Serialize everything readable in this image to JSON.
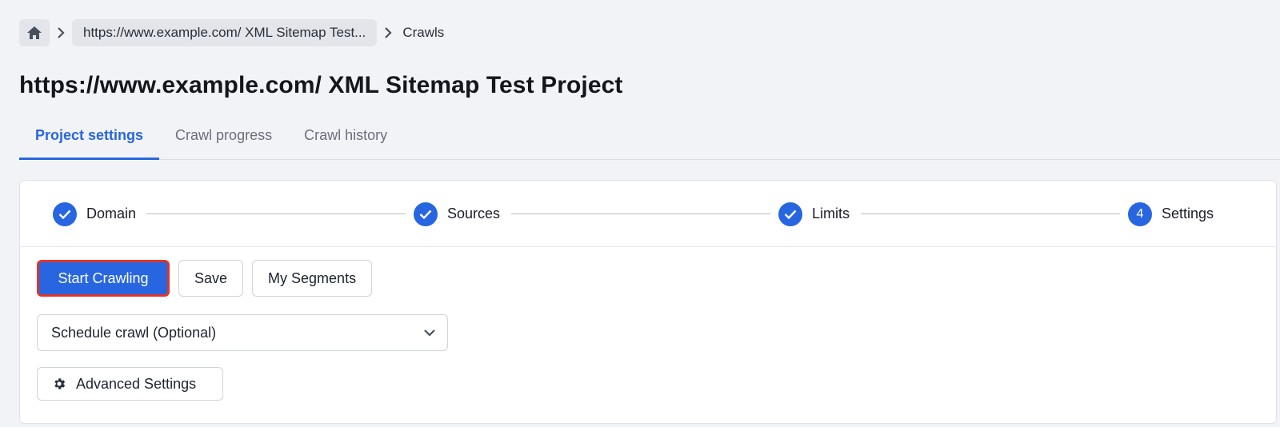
{
  "breadcrumb": {
    "home_icon": "home-icon",
    "project": "https://www.example.com/ XML Sitemap Test...",
    "current": "Crawls"
  },
  "page": {
    "title": "https://www.example.com/ XML Sitemap Test Project"
  },
  "tabs": [
    {
      "label": "Project settings",
      "active": true
    },
    {
      "label": "Crawl progress",
      "active": false
    },
    {
      "label": "Crawl history",
      "active": false
    }
  ],
  "stepper": {
    "steps": [
      {
        "label": "Domain",
        "state": "complete"
      },
      {
        "label": "Sources",
        "state": "complete"
      },
      {
        "label": "Limits",
        "state": "complete"
      },
      {
        "label": "Settings",
        "state": "current",
        "number": "4"
      }
    ]
  },
  "actions": {
    "start_label": "Start Crawling",
    "save_label": "Save",
    "segments_label": "My Segments"
  },
  "schedule": {
    "selected": "Schedule crawl (Optional)"
  },
  "advanced": {
    "label": "Advanced Settings"
  },
  "colors": {
    "accent": "#2766e0",
    "highlight_border": "#e0342b",
    "background": "#f2f3f7"
  }
}
